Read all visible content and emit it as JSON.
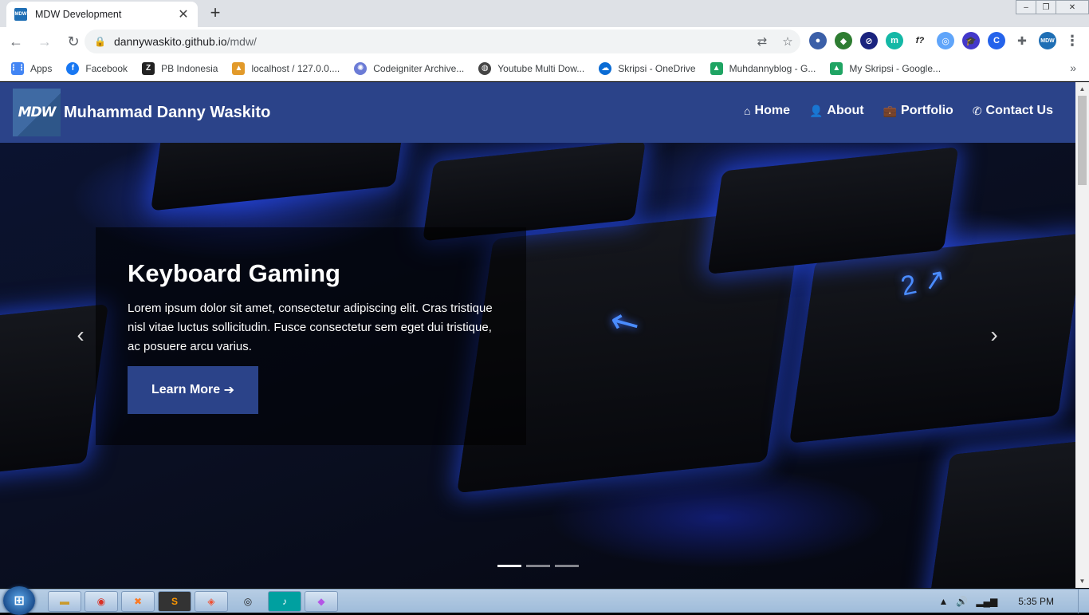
{
  "browser": {
    "tab_title": "MDW Development",
    "tab_favicon": "MDW",
    "url_host": "dannywaskito.github.io",
    "url_path": "/mdw/",
    "bookmarks": [
      {
        "label": "Apps",
        "icon": "apps-grid-icon",
        "color": "#4285f4"
      },
      {
        "label": "Facebook",
        "icon": "facebook-icon",
        "color": "#1877f2"
      },
      {
        "label": "PB Indonesia",
        "icon": "pb-icon",
        "color": "#222222"
      },
      {
        "label": "localhost / 127.0.0....",
        "icon": "phpmyadmin-icon",
        "color": "#e29a2a"
      },
      {
        "label": "Codeigniter Archive...",
        "icon": "react-icon",
        "color": "#6b7bd6"
      },
      {
        "label": "Youtube Multi Dow...",
        "icon": "globe-icon",
        "color": "#444444"
      },
      {
        "label": "Skripsi - OneDrive",
        "icon": "onedrive-icon",
        "color": "#0a6cd5"
      },
      {
        "label": "Muhdannyblog - G...",
        "icon": "drive-icon",
        "color": "#1fa463"
      },
      {
        "label": "My Skripsi - Google...",
        "icon": "drive-icon",
        "color": "#1fa463"
      }
    ],
    "more_bookmarks": "»"
  },
  "site": {
    "logo_text": "MDW",
    "brand": "Muhammad Danny Waskito",
    "nav_color": "#2b4389",
    "menu": [
      {
        "label": "Home",
        "icon": "home-icon",
        "glyph": "⌂"
      },
      {
        "label": "About",
        "icon": "user-icon",
        "glyph": "👤"
      },
      {
        "label": "Portfolio",
        "icon": "briefcase-icon",
        "glyph": "💼"
      },
      {
        "label": "Contact Us",
        "icon": "phone-icon",
        "glyph": "✆"
      }
    ],
    "slide": {
      "title": "Keyboard Gaming",
      "text": "Lorem ipsum dolor sit amet, consectetur adipiscing elit. Cras tristique nisl vitae luctus sollicitudin. Fusce consectetur sem eget dui tristique, ac posuere arcu varius.",
      "button_label": "Learn More"
    },
    "prev_arrow": "‹",
    "next_arrow": "›",
    "slide_count": 3,
    "active_slide": 1
  },
  "taskbar": {
    "time": "5:35 PM",
    "apps": [
      "explorer-icon",
      "chrome-icon",
      "xampp-icon",
      "sublime-icon",
      "git-icon",
      "obs-icon",
      "music-icon",
      "paint-icon"
    ]
  }
}
